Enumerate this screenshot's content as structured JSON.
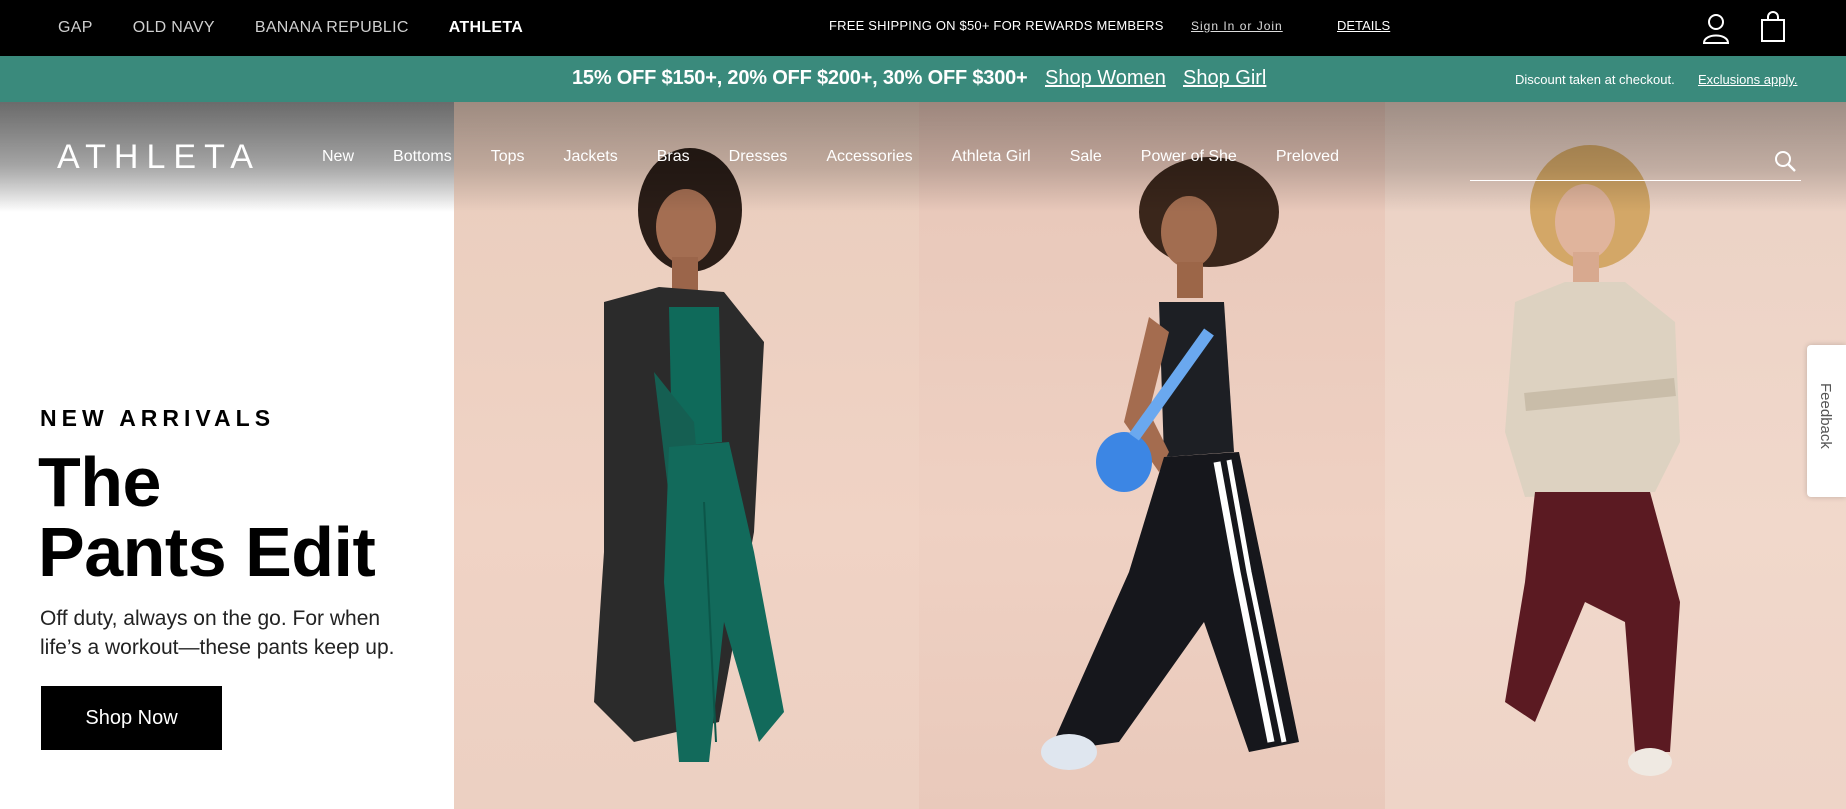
{
  "topbar": {
    "brands": [
      "GAP",
      "OLD NAVY",
      "BANANA REPUBLIC",
      "ATHLETA"
    ],
    "active_brand": "ATHLETA",
    "shipping": "FREE SHIPPING ON $50+ FOR REWARDS MEMBERS",
    "signin": "Sign In or Join",
    "details": "DETAILS",
    "account_icon": "account-icon",
    "bag_icon": "shopping-bag-icon"
  },
  "promo": {
    "main": "15% OFF $150+, 20% OFF $200+, 30% OFF $300+",
    "link_women": "Shop Women",
    "link_girl": "Shop Girl",
    "disclaimer": "Discount taken at checkout.",
    "exclusions": "Exclusions apply.",
    "bg_color": "#3a8a7c"
  },
  "header": {
    "logo": "ATHLETA",
    "nav": [
      "New",
      "Bottoms",
      "Tops",
      "Jackets",
      "Bras",
      "Dresses",
      "Accessories",
      "Athleta Girl",
      "Sale",
      "Power of She",
      "Preloved"
    ],
    "search_placeholder": "",
    "search_icon": "search-icon"
  },
  "hero": {
    "kicker": "NEW ARRIVALS",
    "title_line1": "The",
    "title_line2": "Pants Edit",
    "subtitle": "Off duty, always on the go. For when life’s a workout—these pants keep up.",
    "cta": "Shop Now"
  },
  "feedback": {
    "label": "Feedback"
  }
}
